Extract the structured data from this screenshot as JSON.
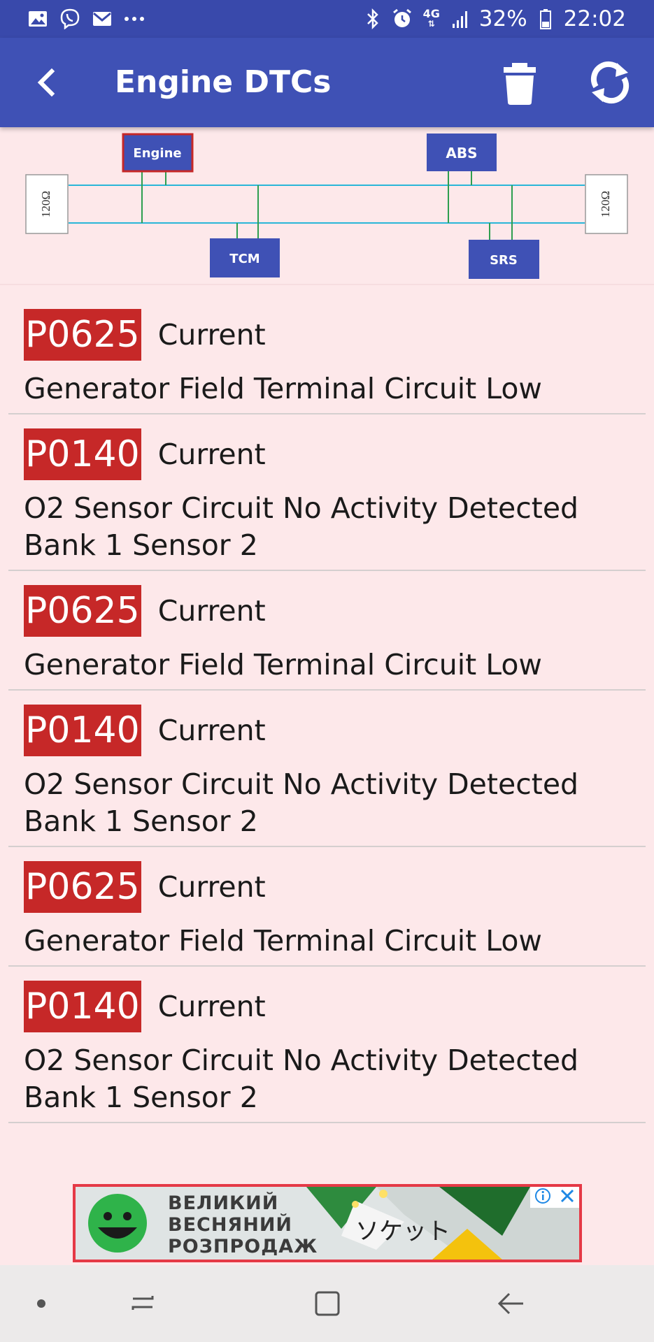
{
  "status_bar": {
    "battery": "32%",
    "time": "22:02",
    "network": "4G",
    "left_icons": [
      "gallery-icon",
      "viber-icon",
      "gmail-icon",
      "more-dots-icon"
    ],
    "right_icons": [
      "bluetooth-icon",
      "alarm-icon",
      "network-4g-icon",
      "signal-icon",
      "battery-icon"
    ]
  },
  "app_bar": {
    "title": "Engine DTCs",
    "back_icon": "back-arrow-icon",
    "actions": [
      "trash-icon",
      "refresh-icon"
    ]
  },
  "can_diagram": {
    "nodes": [
      "Engine",
      "ABS",
      "TCM",
      "SRS"
    ],
    "selected": "Engine",
    "terminator_left": "120Ω",
    "terminator_right": "120Ω",
    "colors": {
      "node": "#3f51b5",
      "selected_border": "#c62828",
      "bus_line": "#29b6d8",
      "stub_line": "#2e9e4f"
    }
  },
  "dtcs": [
    {
      "code": "P0625",
      "status": "Current",
      "description": "Generator Field Terminal Circuit Low"
    },
    {
      "code": "P0140",
      "status": "Current",
      "description": "O2 Sensor Circuit No Activity Detected Bank 1 Sensor 2"
    },
    {
      "code": "P0625",
      "status": "Current",
      "description": "Generator Field Terminal Circuit Low"
    },
    {
      "code": "P0140",
      "status": "Current",
      "description": "O2 Sensor Circuit No Activity Detected Bank 1 Sensor 2"
    },
    {
      "code": "P0625",
      "status": "Current",
      "description": "Generator Field Terminal Circuit Low"
    },
    {
      "code": "P0140",
      "status": "Current",
      "description": "O2 Sensor Circuit No Activity Detected Bank 1 Sensor 2"
    }
  ],
  "ad": {
    "line1": "ВЕЛИКИЙ",
    "line2": "ВЕСНЯНИЙ",
    "line3": "РОЗПРОДАЖ",
    "overlay_text": "ソケット",
    "icons": [
      "adchoices-info-icon",
      "ad-close-icon"
    ]
  },
  "nav_bar": {
    "buttons": [
      "dot-icon",
      "recent-apps-icon",
      "home-icon",
      "back-icon"
    ]
  },
  "colors": {
    "primary": "#3f51b5",
    "status_bar": "#3949ab",
    "background": "#fde8ea",
    "dtc_code_bg": "#c62828"
  }
}
